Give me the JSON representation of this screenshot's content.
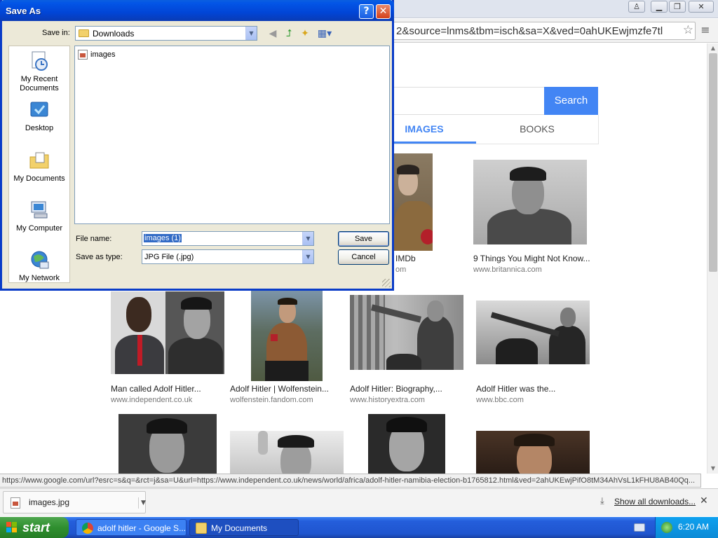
{
  "browser": {
    "address_text": "2&source=lnms&tbm=isch&sa=X&ved=0ahUKEwjmzfe7tl",
    "status_url": "https://www.google.com/url?esrc=s&q=&rct=j&sa=U&url=https://www.independent.co.uk/news/world/africa/adolf-hitler-namibia-election-b1765812.html&ved=2ahUKEwjPifO8tM34AhVsL1kFHU8AB40Qq...",
    "window_controls": {
      "user": "♙",
      "minimize": "▁",
      "restore": "❐",
      "close": "✕"
    }
  },
  "google": {
    "search_button": "Search",
    "tabs": {
      "images": "IMAGES",
      "books": "BOOKS"
    }
  },
  "results": [
    {
      "title": "IMDb",
      "source": "om"
    },
    {
      "title": "9 Things You Might Not Know...",
      "source": "www.britannica.com"
    },
    {
      "title": "Man called Adolf Hitler...",
      "source": "www.independent.co.uk"
    },
    {
      "title": "Adolf Hitler | Wolfenstein...",
      "source": "wolfenstein.fandom.com"
    },
    {
      "title": "Adolf Hitler: Biography,...",
      "source": "www.historyextra.com"
    },
    {
      "title": "Adolf Hitler was the...",
      "source": "www.bbc.com"
    }
  ],
  "downloads": {
    "file": "images.jpg",
    "show_all": "Show all downloads..."
  },
  "taskbar": {
    "start": "start",
    "tasks": [
      {
        "label": "adolf hitler - Google S..."
      },
      {
        "label": "My Documents"
      }
    ],
    "clock": "6:20 AM"
  },
  "dialog": {
    "title": "Save As",
    "save_in_label": "Save in:",
    "save_in_value": "Downloads",
    "places": [
      "My Recent Documents",
      "Desktop",
      "My Documents",
      "My Computer",
      "My Network"
    ],
    "files": [
      {
        "name": "images"
      }
    ],
    "file_name_label": "File name:",
    "file_name_value": "images (1)",
    "save_type_label": "Save as type:",
    "save_type_value": "JPG File (.jpg)",
    "save_button": "Save",
    "cancel_button": "Cancel"
  }
}
